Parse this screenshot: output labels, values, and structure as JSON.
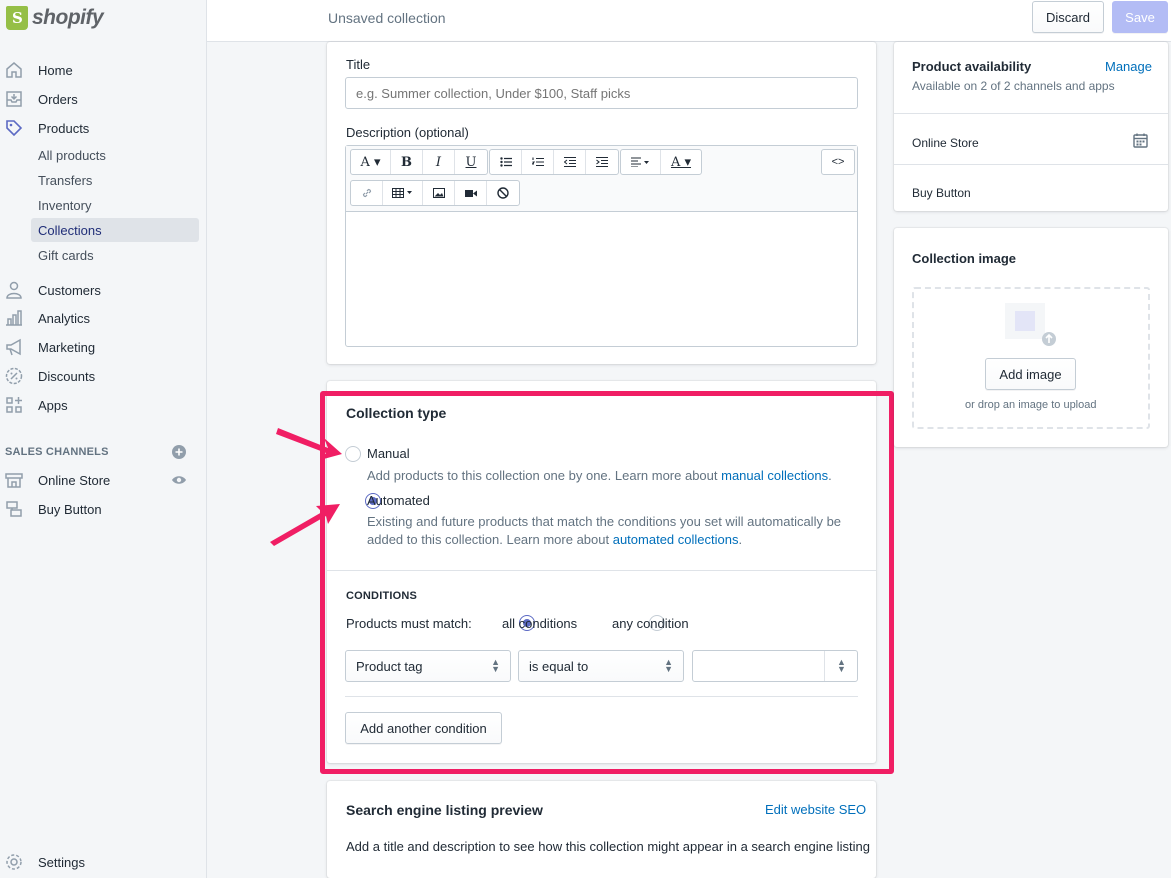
{
  "brand": {
    "name": "shopify"
  },
  "topbar": {
    "title": "Unsaved collection",
    "discard_label": "Discard",
    "save_label": "Save"
  },
  "sidebar": {
    "items": [
      {
        "label": "Home",
        "icon": "home-icon"
      },
      {
        "label": "Orders",
        "icon": "orders-icon"
      },
      {
        "label": "Products",
        "icon": "tag-icon"
      }
    ],
    "product_subitems": [
      "All products",
      "Transfers",
      "Inventory",
      "Collections",
      "Gift cards"
    ],
    "items2": [
      {
        "label": "Customers",
        "icon": "customer-icon"
      },
      {
        "label": "Analytics",
        "icon": "analytics-icon"
      },
      {
        "label": "Marketing",
        "icon": "megaphone-icon"
      },
      {
        "label": "Discounts",
        "icon": "discount-icon"
      },
      {
        "label": "Apps",
        "icon": "apps-icon"
      }
    ],
    "sales_channels_label": "SALES CHANNELS",
    "channels": [
      {
        "label": "Online Store",
        "icon": "store-icon"
      },
      {
        "label": "Buy Button",
        "icon": "buy-button-icon"
      }
    ],
    "settings_label": "Settings"
  },
  "details": {
    "title_label": "Title",
    "title_placeholder": "e.g. Summer collection, Under $100, Staff picks",
    "description_label": "Description (optional)",
    "toolbar_code": "<>"
  },
  "collection_type": {
    "heading": "Collection type",
    "manual_label": "Manual",
    "manual_desc": "Add products to this collection one by one. Learn more about ",
    "manual_link": "manual collections",
    "automated_label": "Automated",
    "automated_desc_line1": "Existing and future products that match the conditions you set will automatically be",
    "automated_desc_line2": "added to this collection. Learn more about ",
    "automated_link": "automated collections",
    "selected": "Automated"
  },
  "conditions": {
    "heading": "CONDITIONS",
    "match_label": "Products must match:",
    "all_label": "all conditions",
    "any_label": "any condition",
    "field": "Product tag",
    "operator": "is equal to",
    "value": "",
    "add_label": "Add another condition"
  },
  "seo": {
    "heading": "Search engine listing preview",
    "edit_link": "Edit website SEO",
    "desc": "Add a title and description to see how this collection might appear in a search engine listing"
  },
  "availability": {
    "heading": "Product availability",
    "manage_link": "Manage",
    "subtitle": "Available on 2 of 2 channels and apps",
    "channels": [
      "Online Store",
      "Buy Button"
    ]
  },
  "collection_image": {
    "heading": "Collection image",
    "add_label": "Add image",
    "drop_hint": "or drop an image to upload"
  },
  "colors": {
    "accent": "#5c6ac4",
    "highlight": "#f01e64",
    "link": "#006fbb"
  }
}
